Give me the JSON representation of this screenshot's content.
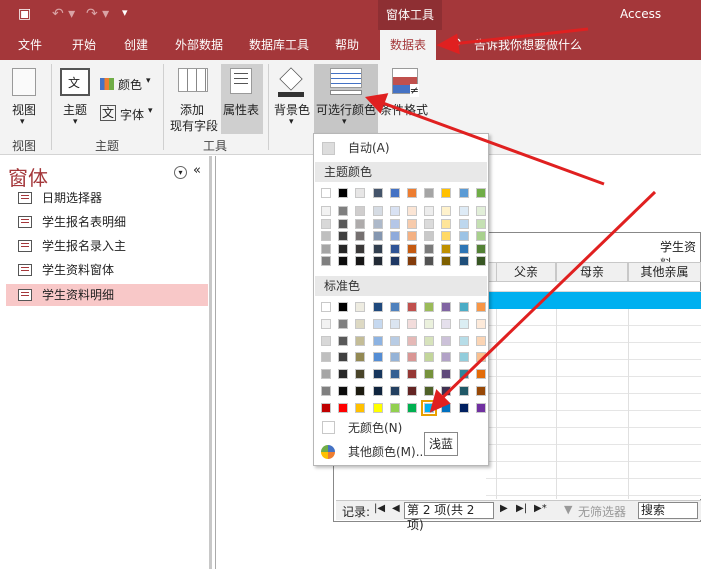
{
  "title_bar": {
    "context_tab": "窗体工具",
    "app_name": "Access"
  },
  "tabs": [
    "文件",
    "开始",
    "创建",
    "外部数据",
    "数据库工具",
    "帮助",
    "数据表"
  ],
  "tell_me": "告诉我你想要做什么",
  "ribbon": {
    "view": "视图",
    "theme": "主题",
    "colors": "颜色",
    "fonts": "字体",
    "add_field_1": "添加",
    "add_field_2": "现有字段",
    "property_sheet": "属性表",
    "background_color": "背景色",
    "alt_row_color": "可选行颜色",
    "conditional_format": "条件格式",
    "groups": {
      "views": "视图",
      "themes": "主题",
      "tools": "工具"
    }
  },
  "nav": {
    "title": "窗体",
    "items": [
      "日期选择器",
      "学生报名表明细",
      "学生报名录入主",
      "学生资料窗体",
      "学生资料明细"
    ],
    "selected_index": 4
  },
  "form": {
    "title": "学生资料",
    "columns": [
      "父亲",
      "母亲",
      "其他亲属"
    ],
    "record_label": "记录:",
    "record_nav": "第 2 项(共 2 项)",
    "filter_label": "无筛选器",
    "search_label": "搜索"
  },
  "color_panel": {
    "auto_label": "自动(A)",
    "theme_header": "主题颜色",
    "standard_header": "标准色",
    "no_color_label": "无颜色(N)",
    "more_colors_label": "其他颜色(M)...",
    "tooltip": "浅蓝",
    "theme_top": [
      "#ffffff",
      "#000000",
      "#e7e6e6",
      "#44546a",
      "#4472c4",
      "#ed7d31",
      "#a5a5a5",
      "#ffc000",
      "#5b9bd5",
      "#70ad47"
    ],
    "theme_shades": [
      [
        "#f2f2f2",
        "#7f7f7f",
        "#d0cece",
        "#d6dce4",
        "#d9e2f3",
        "#fbe5d5",
        "#ededed",
        "#fff2cc",
        "#deebf6",
        "#e2efd9"
      ],
      [
        "#d8d8d8",
        "#595959",
        "#aeabab",
        "#adb9ca",
        "#b4c6e7",
        "#f7cbac",
        "#dbdbdb",
        "#fee599",
        "#bdd7ee",
        "#c5e0b3"
      ],
      [
        "#bfbfbf",
        "#3f3f3f",
        "#757070",
        "#8496b0",
        "#8eaadb",
        "#f4b183",
        "#c9c9c9",
        "#ffd965",
        "#9cc3e5",
        "#a8d08d"
      ],
      [
        "#a5a5a5",
        "#262626",
        "#3a3838",
        "#323f4f",
        "#2f5496",
        "#c55a11",
        "#7b7b7b",
        "#bf9000",
        "#2e75b5",
        "#538135"
      ],
      [
        "#7f7f7f",
        "#0c0c0c",
        "#171616",
        "#222a35",
        "#1f3864",
        "#833c0b",
        "#525252",
        "#7f6000",
        "#1e4e79",
        "#375623"
      ]
    ],
    "standard_rows": [
      [
        "#ffffff",
        "#000000",
        "#eeece1",
        "#1f497d",
        "#4f81bd",
        "#c0504d",
        "#9bbb59",
        "#8064a2",
        "#4bacc6",
        "#f79646"
      ],
      [
        "#f2f2f2",
        "#7f7f7f",
        "#ddd9c3",
        "#c6d9f0",
        "#dbe5f1",
        "#f2dcdb",
        "#ebf1dd",
        "#e5e0ec",
        "#dbeef3",
        "#fdeada"
      ],
      [
        "#d8d8d8",
        "#595959",
        "#c4bd97",
        "#8db3e2",
        "#b8cce4",
        "#e5b9b7",
        "#d7e3bc",
        "#ccc1d9",
        "#b7dde8",
        "#fbd5b5"
      ],
      [
        "#bfbfbf",
        "#3f3f3f",
        "#938953",
        "#548dd4",
        "#95b3d7",
        "#d99694",
        "#c3d69b",
        "#b2a2c7",
        "#92cddc",
        "#fac08f"
      ],
      [
        "#a5a5a5",
        "#262626",
        "#494429",
        "#17365d",
        "#366092",
        "#953734",
        "#76923c",
        "#5f497a",
        "#31859b",
        "#e36c09"
      ],
      [
        "#7f7f7f",
        "#0c0c0c",
        "#1d1b10",
        "#0f243e",
        "#244061",
        "#632423",
        "#4f6128",
        "#3f3151",
        "#205867",
        "#974806"
      ],
      [
        "#c00000",
        "#ff0000",
        "#ffc000",
        "#ffff00",
        "#92d050",
        "#00b050",
        "#00b0f0",
        "#0070c0",
        "#002060",
        "#7030a0"
      ]
    ]
  },
  "accent": "#a4373a",
  "highlight_row": "#00b0f0"
}
